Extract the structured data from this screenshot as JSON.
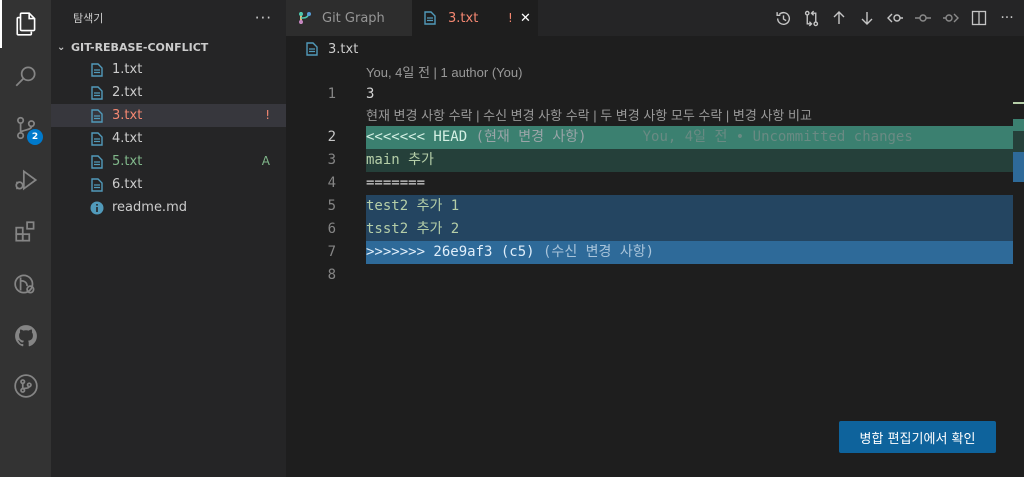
{
  "activity_bar": {
    "source_control_badge": "2"
  },
  "sidebar": {
    "title": "탐색기",
    "more_label": "···",
    "section_title": "GIT-REBASE-CONFLICT",
    "files": [
      {
        "name": "1.txt",
        "status": ""
      },
      {
        "name": "2.txt",
        "status": ""
      },
      {
        "name": "3.txt",
        "status": "!"
      },
      {
        "name": "4.txt",
        "status": ""
      },
      {
        "name": "5.txt",
        "status": "A"
      },
      {
        "name": "6.txt",
        "status": ""
      },
      {
        "name": "readme.md",
        "status": ""
      }
    ]
  },
  "tabs": [
    {
      "label": "Git Graph"
    },
    {
      "label": "3.txt",
      "status": "!",
      "close": "✕"
    }
  ],
  "breadcrumb": {
    "file": "3.txt"
  },
  "editor": {
    "codelens_top": "You, 4일 전 | 1 author (You)",
    "codelens_conflict": "현재 변경 사항 수락 | 수신 변경 사항 수락 | 두 변경 사항 모두 수락 | 변경 사항 비교",
    "lines": [
      {
        "n": "1",
        "text": "3"
      },
      {
        "n": "2",
        "text": "<<<<<<< HEAD",
        "suffix": " (현재 변경 사항)",
        "blame": "You, 4일 전 • Uncommitted changes"
      },
      {
        "n": "3",
        "text": "main 추가"
      },
      {
        "n": "4",
        "text": "======="
      },
      {
        "n": "5",
        "text": "test2 추가 1"
      },
      {
        "n": "6",
        "text": "tsst2 추가 2"
      },
      {
        "n": "7",
        "text": ">>>>>>> 26e9af3 (c5)",
        "suffix": " (수신 변경 사항)"
      },
      {
        "n": "8",
        "text": ""
      }
    ]
  },
  "merge_button": {
    "label": "병합 편집기에서 확인"
  },
  "colors": {
    "accent": "#007acc",
    "conflict_red": "#f48771",
    "added_green": "#81b88b",
    "current_change": "#3b8070",
    "incoming_change": "#2e6a99"
  }
}
